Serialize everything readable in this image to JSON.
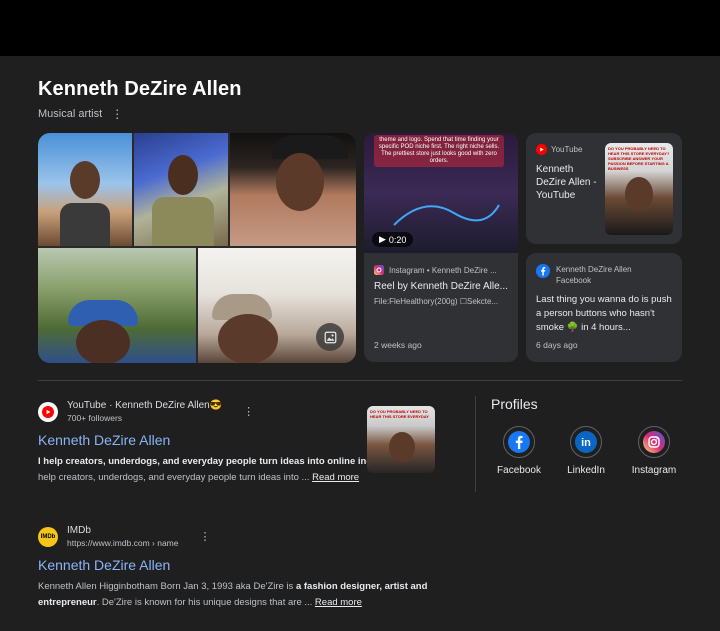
{
  "header": {
    "title": "Kenneth DeZire Allen",
    "subtitle": "Musical artist"
  },
  "reel_card": {
    "thumb_caption": "theme and logo. Spend that time finding your specific POD niche first. The right niche sells. The prettiest store just looks good with zero orders.",
    "duration": "0:20",
    "source": "Instagram • Kenneth DeZire ...",
    "title": "Reel by Kenneth DeZire Alle...",
    "meta": "File:FleHealthory(200g) ☐Sekcte...",
    "ago": "2 weeks ago"
  },
  "youtube_card": {
    "source": "YouTube",
    "title": "Kenneth DeZire Allen - YouTube",
    "thumb_text": "DO YOU PROBABLY NEED TO HEAR THIS STORE EVERYDAY? SUBSCRIBE ANSWER YOUR PASSION BEFORE STARTING A BUSINESS"
  },
  "facebook_card": {
    "name": "Kenneth DeZire Allen",
    "site": "Facebook",
    "body": "Last thing you wanna do is push a person buttons who hasn't smoke 🌳 in 4 hours...",
    "ago": "6 days ago"
  },
  "results": [
    {
      "source": "YouTube · Kenneth DeZire Allen😎",
      "sub": "700+ followers",
      "title": "Kenneth DeZire Allen",
      "snippet_bold": "I help creators, underdogs, and everyday people turn ideas into online income",
      "snippet_rest": ". ...more. I help creators, underdogs, and everyday people turn ideas into ... ",
      "read_more": "Read more",
      "thumb_text": "DO YOU PROBABLY NEED TO HEAR THIS STORE EVERYDAY"
    },
    {
      "source": "IMDb",
      "sub": "https://www.imdb.com › name",
      "favicon_text": "IMDb",
      "title": "Kenneth DeZire Allen",
      "snippet_pre": "Kenneth Allen Higginbotham Born Jan 3, 1993 aka De'Zire is ",
      "snippet_bold": "a fashion designer, artist and entrepreneur",
      "snippet_rest": ". De'Zire is known for his unique designs that are ... ",
      "read_more": "Read more"
    }
  ],
  "profiles": {
    "title": "Profiles",
    "items": [
      {
        "label": "Facebook",
        "icon": "facebook-icon",
        "color": "#1877f2"
      },
      {
        "label": "LinkedIn",
        "icon": "linkedin-icon",
        "color": "#0a66c2"
      },
      {
        "label": "Instagram",
        "icon": "instagram-icon",
        "color": "#e1306c"
      }
    ]
  },
  "colors": {
    "background": "#1f1f1f",
    "card": "#303134",
    "link": "#8ab4f8",
    "youtube_red": "#ff0000",
    "imdb_yellow": "#f5c518"
  }
}
